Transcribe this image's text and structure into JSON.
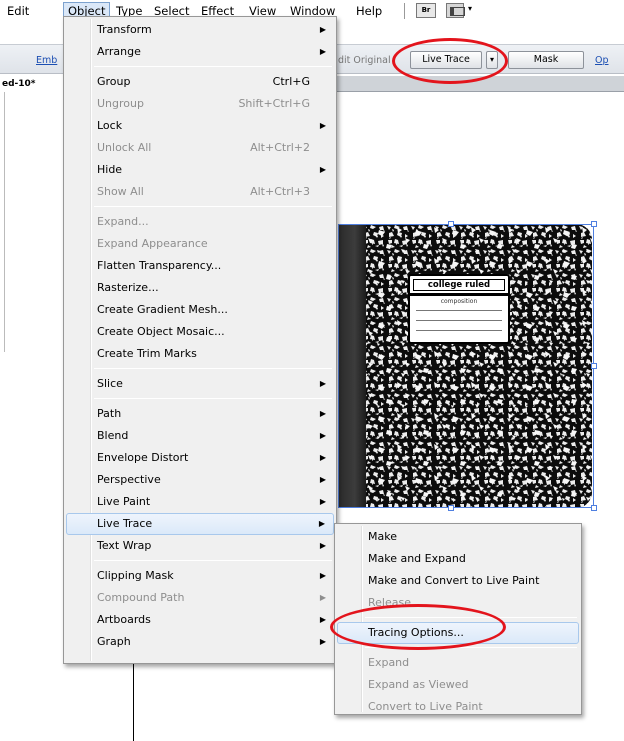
{
  "menubar": {
    "items": [
      "Edit",
      "Object",
      "Type",
      "Select",
      "Effect",
      "View",
      "Window",
      "Help"
    ],
    "bridge_label": "Br",
    "arrange_dropdown": "▾"
  },
  "controlbar": {
    "embed_link": "Emb",
    "edit_original": "dit Original",
    "live_trace": "Live Trace",
    "live_trace_dropdown": "▾",
    "mask": "Mask",
    "options_link": "Op"
  },
  "document_tab": "ed-10*",
  "notebook": {
    "title": "college ruled",
    "subtitle": "composition"
  },
  "object_menu": [
    {
      "label": "Transform",
      "submenu": true
    },
    {
      "label": "Arrange",
      "submenu": true
    },
    {
      "sep": true
    },
    {
      "label": "Group",
      "shortcut": "Ctrl+G"
    },
    {
      "label": "Ungroup",
      "shortcut": "Shift+Ctrl+G",
      "disabled": true
    },
    {
      "label": "Lock",
      "submenu": true
    },
    {
      "label": "Unlock All",
      "shortcut": "Alt+Ctrl+2",
      "disabled": true
    },
    {
      "label": "Hide",
      "submenu": true
    },
    {
      "label": "Show All",
      "shortcut": "Alt+Ctrl+3",
      "disabled": true
    },
    {
      "sep": true
    },
    {
      "label": "Expand...",
      "disabled": true
    },
    {
      "label": "Expand Appearance",
      "disabled": true
    },
    {
      "label": "Flatten Transparency..."
    },
    {
      "label": "Rasterize..."
    },
    {
      "label": "Create Gradient Mesh..."
    },
    {
      "label": "Create Object Mosaic..."
    },
    {
      "label": "Create Trim Marks"
    },
    {
      "sep": true
    },
    {
      "label": "Slice",
      "submenu": true
    },
    {
      "sep": true
    },
    {
      "label": "Path",
      "submenu": true
    },
    {
      "label": "Blend",
      "submenu": true
    },
    {
      "label": "Envelope Distort",
      "submenu": true
    },
    {
      "label": "Perspective",
      "submenu": true
    },
    {
      "label": "Live Paint",
      "submenu": true
    },
    {
      "label": "Live Trace",
      "submenu": true,
      "hover": true
    },
    {
      "label": "Text Wrap",
      "submenu": true
    },
    {
      "sep": true
    },
    {
      "label": "Clipping Mask",
      "submenu": true
    },
    {
      "label": "Compound Path",
      "submenu": true,
      "disabled": true
    },
    {
      "label": "Artboards",
      "submenu": true
    },
    {
      "label": "Graph",
      "submenu": true
    }
  ],
  "live_trace_menu": [
    {
      "label": "Make"
    },
    {
      "label": "Make and Expand"
    },
    {
      "label": "Make and Convert to Live Paint"
    },
    {
      "label": "Release",
      "disabled": true
    },
    {
      "sep": true
    },
    {
      "label": "Tracing Options...",
      "hover": true
    },
    {
      "sep": true
    },
    {
      "label": "Expand",
      "disabled": true
    },
    {
      "label": "Expand as Viewed",
      "disabled": true
    },
    {
      "label": "Convert to Live Paint",
      "disabled": true
    }
  ],
  "colors": {
    "highlight_circle": "#e3141c",
    "selection": "#4f7fe0"
  }
}
